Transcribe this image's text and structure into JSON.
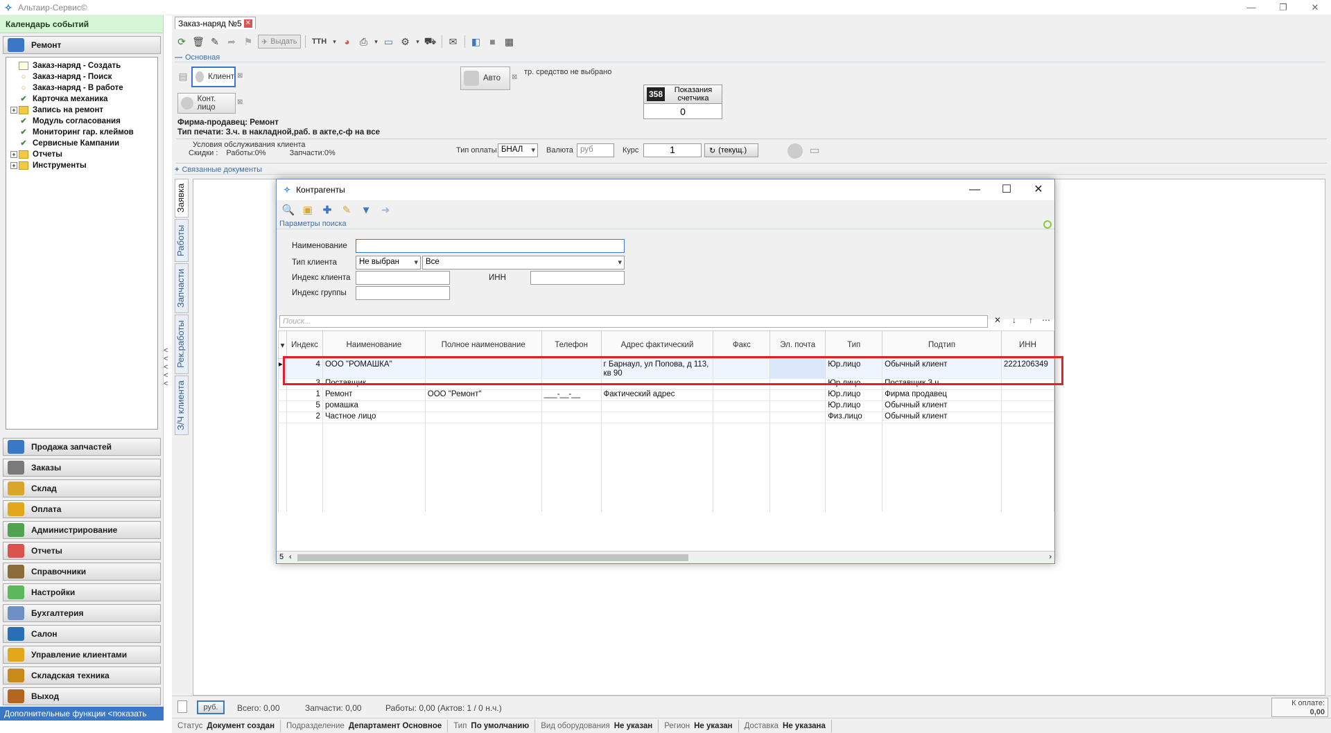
{
  "window": {
    "title": "Альтаир-Сервис©",
    "controls": [
      "—",
      "❐",
      "✕"
    ]
  },
  "left": {
    "calendar": "Календарь событий",
    "section": "Ремонт",
    "tree": [
      {
        "label": "Заказ-наряд - Создать",
        "icon": "doc",
        "exp": ""
      },
      {
        "label": "Заказ-наряд - Поиск",
        "icon": "circle",
        "exp": ""
      },
      {
        "label": "Заказ-наряд - В работе",
        "icon": "circle",
        "exp": ""
      },
      {
        "label": "Карточка механика",
        "icon": "check",
        "exp": ""
      },
      {
        "label": "Запись на ремонт",
        "icon": "folder",
        "exp": "+"
      },
      {
        "label": "Модуль согласования",
        "icon": "check",
        "exp": ""
      },
      {
        "label": "Мониторинг гар. клеймов",
        "icon": "check",
        "exp": ""
      },
      {
        "label": "Сервисные Кампании",
        "icon": "check",
        "exp": ""
      },
      {
        "label": "Отчеты",
        "icon": "folder",
        "exp": "+"
      },
      {
        "label": "Инструменты",
        "icon": "folder",
        "exp": "+"
      }
    ],
    "nav": [
      {
        "label": "Продажа запчастей",
        "color": "#3a78c7"
      },
      {
        "label": "Заказы",
        "color": "#7a7a7a"
      },
      {
        "label": "Склад",
        "color": "#d9a52a"
      },
      {
        "label": "Оплата",
        "color": "#e2a81c"
      },
      {
        "label": "Администрирование",
        "color": "#4fa34f"
      },
      {
        "label": "Отчеты",
        "color": "#d9534f"
      },
      {
        "label": "Справочники",
        "color": "#8a6d3b"
      },
      {
        "label": "Настройки",
        "color": "#5cb85c"
      },
      {
        "label": "Бухгалтерия",
        "color": "#6f8fc7"
      },
      {
        "label": "Салон",
        "color": "#2a6fb5"
      },
      {
        "label": "Управление клиентами",
        "color": "#e2a81c"
      },
      {
        "label": "Складская техника",
        "color": "#c98a1a"
      },
      {
        "label": "Выход",
        "color": "#b5651d"
      }
    ],
    "extra": "Дополнительные функции <показать"
  },
  "main": {
    "tab": "Заказ-наряд №5",
    "toolbar_issue": "Выдать",
    "toolbar_ttn": "ТТН",
    "section_main": "Основная",
    "client_btn": "Клиент",
    "auto_btn": "Авто",
    "no_vehicle": "тр. средство не выбрано",
    "contact_btn": "Конт. лицо",
    "counter_label": "Показания счетчика",
    "counter_digits": "358",
    "counter_value": "0",
    "firm": "Фирма-продавец: Ремонт",
    "print_type": "Тип печати: З.ч. в накладной,раб. в акте,с-ф на все",
    "cond_title": "Условия обслуживания клиента",
    "cond_discounts": "Скидки :",
    "cond_works": "Работы:0%",
    "cond_parts": "Запчасти:0%",
    "pay_type_label": "Тип оплаты",
    "pay_type": "БНАЛ",
    "currency_label": "Валюта",
    "currency": "руб",
    "rate_label": "Курс",
    "rate": "1",
    "rate_btn": "(текущ.)",
    "linked_docs": "Связанные документы",
    "vtabs": [
      "Заявка",
      "Работы",
      "Запчасти",
      "Рек.работы",
      "З/Ч клиента"
    ]
  },
  "bottom": {
    "currency_btn": "руб.",
    "total": "Всего: 0,00",
    "parts": "Запчасти: 0,00",
    "works": "Работы: 0,00 (Актов: 1 / 0 н.ч.)",
    "to_pay_label": "К оплате:",
    "to_pay": "0,00",
    "status": [
      {
        "k": "Статус",
        "v": "Документ создан"
      },
      {
        "k": "Подразделение",
        "v": "Департамент Основное"
      },
      {
        "k": "Тип",
        "v": "По умолчанию"
      },
      {
        "k": "Вид оборудования",
        "v": "Не указан"
      },
      {
        "k": "Регион",
        "v": "Не указан"
      },
      {
        "k": "Доставка",
        "v": "Не указана"
      }
    ]
  },
  "dialog": {
    "title": "Контрагенты",
    "params_title": "Параметры поиска",
    "name_label": "Наименование",
    "client_type_label": "Тип клиента",
    "client_type": "Не выбран",
    "client_type2": "Все",
    "client_index_label": "Индекс клиента",
    "inn_label": "ИНН",
    "group_index_label": "Индекс группы",
    "search_placeholder": "Поиск...",
    "columns": [
      "Индекс",
      "Наименование",
      "Полное наименование",
      "Телефон",
      "Адрес фактический",
      "Факс",
      "Эл. почта",
      "Тип",
      "Подтип",
      "ИНН"
    ],
    "rows": [
      [
        "4",
        "ООО \"РОМАШКА\"",
        "",
        "",
        "г Барнаул, ул Попова, д 113, кв 90",
        "",
        "",
        "Юр.лицо",
        "Обычный клиент",
        "2221206349"
      ],
      [
        "3",
        "Поставщик",
        "",
        "",
        "",
        "",
        "",
        "Юр.лицо",
        "Поставщик З.ч.",
        ""
      ],
      [
        "1",
        "Ремонт",
        "ООО \"Ремонт\"",
        "___-__-__",
        "Фактический адрес",
        "",
        "",
        "Юр.лицо",
        "Фирма продавец",
        ""
      ],
      [
        "5",
        "ромашка",
        "",
        "",
        "",
        "",
        "",
        "Юр.лицо",
        "Обычный клиент",
        ""
      ],
      [
        "2",
        "Частное лицо",
        "",
        "",
        "",
        "",
        "",
        "Физ.лицо",
        "Обычный клиент",
        ""
      ]
    ],
    "count": "5"
  }
}
